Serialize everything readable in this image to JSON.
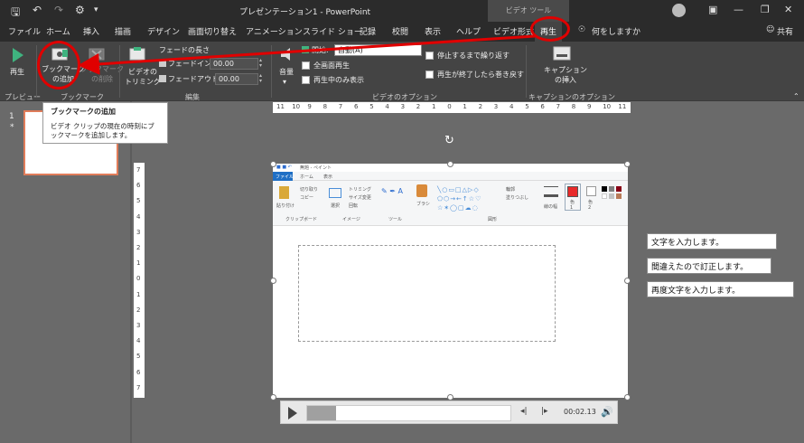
{
  "titlebar": {
    "title": "プレゼンテーション1 - PowerPoint",
    "context_tab": "ビデオ ツール"
  },
  "tabs": [
    {
      "label": "ファイル"
    },
    {
      "label": "ホーム"
    },
    {
      "label": "挿入"
    },
    {
      "label": "描画"
    },
    {
      "label": "デザイン"
    },
    {
      "label": "画面切り替え"
    },
    {
      "label": "アニメーション"
    },
    {
      "label": "スライド ショー"
    },
    {
      "label": "記録"
    },
    {
      "label": "校閲"
    },
    {
      "label": "表示"
    },
    {
      "label": "ヘルプ"
    },
    {
      "label": "ビデオ形式"
    },
    {
      "label": "再生"
    }
  ],
  "tell_me": "何をしますか",
  "share": "共有",
  "ribbon": {
    "play": "再生",
    "add_bookmark": "ブックマーク\nの追加",
    "remove_bookmark": "ブックマーク\nの削除",
    "trim_video": "ビデオの\nトリミング",
    "fade_duration": "フェードの長さ",
    "fade_in": "フェードイン:",
    "fade_in_value": "00.00",
    "fade_out": "フェードアウト:",
    "fade_out_value": "00.00",
    "volume": "音量",
    "start": "開始:",
    "start_value": "自動(A)",
    "fullscreen": "全画面再生",
    "hide_not_playing": "再生中のみ表示",
    "loop": "停止するまで繰り返す",
    "rewind": "再生が終了したら巻き戻す",
    "insert_captions": "キャプション\nの挿入",
    "groups": {
      "preview": "プレビュー",
      "bookmarks": "ブックマーク",
      "editing": "編集",
      "video_options": "ビデオのオプション",
      "caption_options": "キャプションのオプション"
    }
  },
  "tooltip": {
    "title": "ブックマークの追加",
    "description": "ビデオ クリップの現在の時刻にブックマークを追加します。"
  },
  "slides": {
    "number": "1",
    "marker": "*"
  },
  "ruler_h": [
    "11",
    "10",
    "9",
    "8",
    "7",
    "6",
    "5",
    "4",
    "3",
    "2",
    "1",
    "0",
    "1",
    "2",
    "3",
    "4",
    "5",
    "6",
    "7",
    "8",
    "9",
    "10",
    "11"
  ],
  "ruler_v": [
    "7",
    "6",
    "5",
    "4",
    "3",
    "2",
    "1",
    "0",
    "1",
    "2",
    "3",
    "4",
    "5",
    "6",
    "7"
  ],
  "paint": {
    "title": "無題 - ペイント",
    "tab_file": "ファイル",
    "tab_home": "ホーム",
    "tab_view": "表示",
    "paste": "貼り付け",
    "cut": "切り取り",
    "copy": "コピー",
    "clipboard": "クリップボード",
    "select": "選択",
    "crop": "トリミング",
    "resize": "サイズ変更",
    "rotate": "回転",
    "image": "イメージ",
    "tools": "ツール",
    "brushes": "ブラシ",
    "outline": "輪郭",
    "fill": "塗りつぶし",
    "shapes": "図形",
    "size": "線の幅",
    "color1": "色\n1",
    "color2": "色\n2",
    "primary_color": "#e82a2a"
  },
  "player": {
    "time": "00:02.13",
    "progress": 0.14
  },
  "notes": [
    "文字を入力します。",
    "間違えたので訂正します。",
    "再度文字を入力します。"
  ]
}
